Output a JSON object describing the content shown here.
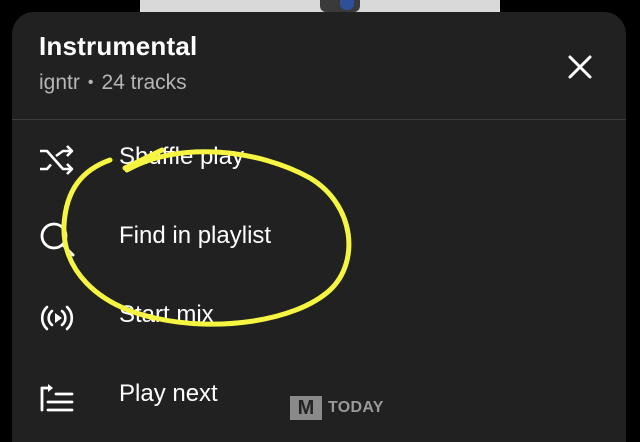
{
  "playlist": {
    "title": "Instrumental",
    "owner": "igntr",
    "separator": "•",
    "track_count": "24 tracks"
  },
  "close_icon": "close-icon",
  "menu": {
    "items": [
      {
        "label": "Shuffle play",
        "icon": "shuffle-icon"
      },
      {
        "label": "Find in playlist",
        "icon": "search-icon"
      },
      {
        "label": "Start mix",
        "icon": "radio-broadcast-icon"
      },
      {
        "label": "Play next",
        "icon": "play-next-icon"
      }
    ]
  },
  "annotation": {
    "color": "#f5f542"
  },
  "watermark": {
    "logo_letter": "M",
    "text": "TODAY"
  },
  "colors": {
    "sheet": "#212121",
    "subtitle": "#b5b5b5",
    "divider": "#3d3d3d"
  }
}
